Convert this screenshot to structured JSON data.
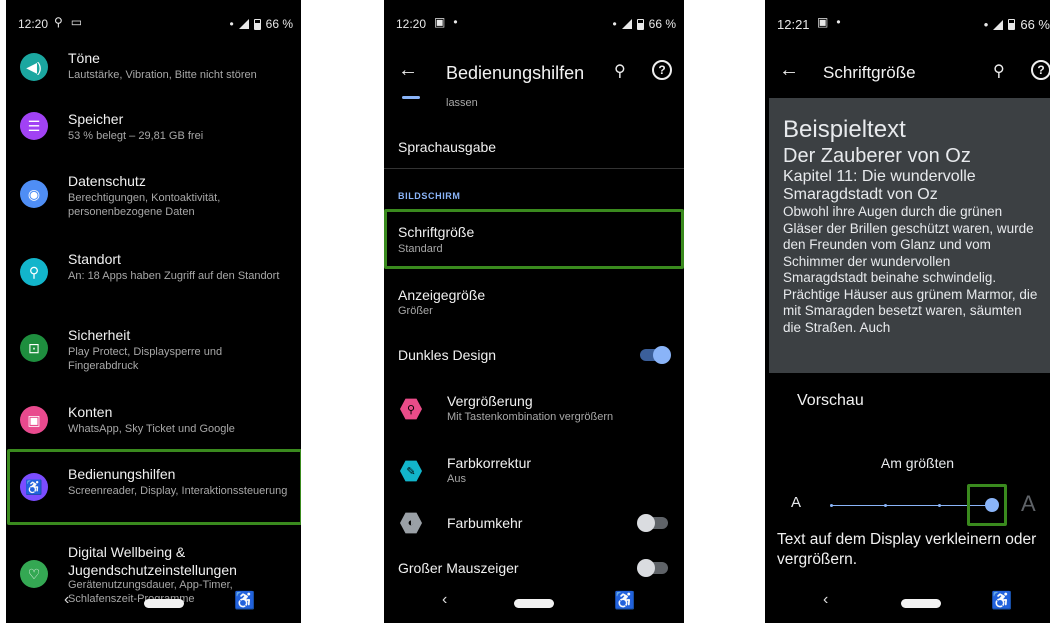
{
  "screen1": {
    "status": {
      "time": "12:20",
      "battery": "66 %"
    },
    "items": [
      {
        "title": "Töne",
        "subtitle": "Lautstärke, Vibration, Bitte nicht stören",
        "icon": "volume-icon",
        "color": "#1ba7a0"
      },
      {
        "title": "Speicher",
        "subtitle": "53 % belegt – 29,81 GB frei",
        "icon": "storage-icon",
        "color": "#a142f4"
      },
      {
        "title": "Datenschutz",
        "subtitle": "Berechtigungen, Kontoaktivität, personenbezogene Daten",
        "icon": "eye-icon",
        "color": "#4f8ef5"
      },
      {
        "title": "Standort",
        "subtitle": "An: 18 Apps haben Zugriff auf den Standort",
        "icon": "location-icon",
        "color": "#12b5cb"
      },
      {
        "title": "Sicherheit",
        "subtitle": "Play Protect, Displaysperre und Fingerabdruck",
        "icon": "lock-icon",
        "color": "#1e8e3e"
      },
      {
        "title": "Konten",
        "subtitle": "WhatsApp, Sky Ticket und Google",
        "icon": "account-icon",
        "color": "#e94a8e"
      },
      {
        "title": "Bedienungshilfen",
        "subtitle": "Screenreader, Display, Interaktionssteuerung",
        "icon": "accessibility-icon",
        "color": "#7b4dff"
      },
      {
        "title": "Digital Wellbeing & Jugendschutzeinstellungen",
        "subtitle": "Gerätenutzungsdauer, App-Timer, Schlafenszeit-Programme",
        "icon": "wellbeing-icon",
        "color": "#34a853"
      }
    ]
  },
  "screen2": {
    "status": {
      "time": "12:20",
      "battery": "66 %"
    },
    "title": "Bedienungshilfen",
    "partial_text": "lassen",
    "tts": "Sprachausgabe",
    "section": "BILDSCHIRM",
    "font_size": {
      "title": "Schriftgröße",
      "subtitle": "Standard"
    },
    "display_size": {
      "title": "Anzeigegröße",
      "subtitle": "Größer"
    },
    "dark_theme": {
      "title": "Dunkles Design",
      "on": true
    },
    "magnification": {
      "title": "Vergrößerung",
      "subtitle": "Mit Tastenkombination vergrößern"
    },
    "color_correction": {
      "title": "Farbkorrektur",
      "subtitle": "Aus"
    },
    "color_inversion": {
      "title": "Farbumkehr",
      "on": false
    },
    "large_pointer": {
      "title": "Großer Mauszeiger",
      "on": false
    }
  },
  "screen3": {
    "status": {
      "time": "12:21",
      "battery": "66 %"
    },
    "title": "Schriftgröße",
    "preview": {
      "heading": "Beispieltext",
      "book": "Der Zauberer von Oz",
      "chapter": "Kapitel 11: Die wundervolle Smaragdstadt von Oz",
      "body": "Obwohl ihre Augen durch die grünen Gläser der Brillen geschützt waren, wurde den Freunden vom Glanz und vom Schimmer der wundervollen Smaragdstadt beinahe schwindelig. Prächtige Häuser aus grünem Marmor, die mit Smaragden besetzt waren, säumten die Straßen. Auch"
    },
    "preview_label": "Vorschau",
    "level_label": "Am größten",
    "small_a": "A",
    "large_a": "A",
    "slider_level": 4,
    "slider_max": 4,
    "description": "Text auf dem Display verkleinern oder vergrößern."
  }
}
